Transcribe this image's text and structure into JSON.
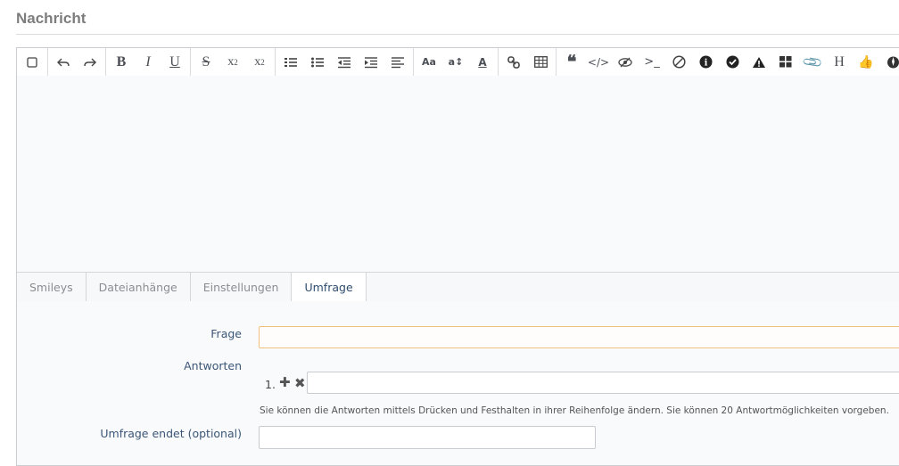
{
  "section": {
    "title": "Nachricht"
  },
  "toolbar": {
    "groups": [
      [
        "checkbox-icon"
      ],
      [
        "undo-icon",
        "redo-icon"
      ],
      [
        "bold-icon",
        "italic-icon",
        "underline-icon"
      ],
      [
        "strikethrough-icon",
        "subscript-icon",
        "superscript-icon"
      ],
      [
        "ordered-list-icon",
        "unordered-list-icon",
        "outdent-icon",
        "indent-icon",
        "align-icon"
      ],
      [
        "font-family-icon",
        "font-size-icon",
        "font-color-icon"
      ],
      [
        "link-icon",
        "table-icon"
      ],
      [
        "quote-icon",
        "code-icon",
        "spoiler-icon",
        "inline-code-icon",
        "strike-circle-icon",
        "info-icon",
        "check-circle-icon",
        "warning-icon",
        "grid-icon",
        "attachment-icon",
        "heading-icon",
        "thumbs-up-icon",
        "rebel-icon",
        "image-icon"
      ]
    ]
  },
  "tabs": [
    {
      "label": "Smileys",
      "active": false
    },
    {
      "label": "Dateianhänge",
      "active": false
    },
    {
      "label": "Einstellungen",
      "active": false
    },
    {
      "label": "Umfrage",
      "active": true
    }
  ],
  "poll": {
    "question_label": "Frage",
    "question_value": "",
    "answers_label": "Antworten",
    "answer_number": "1.",
    "answer_value": "",
    "hint": "Sie können die Antworten mittels Drücken und Festhalten in ihrer Reihenfolge ändern. Sie können 20 Antwortmöglichkeiten vorgeben.",
    "end_label": "Umfrage endet (optional)",
    "end_value": ""
  },
  "colors": {
    "focus_border": "#f2c07d",
    "label": "#3b5677"
  }
}
